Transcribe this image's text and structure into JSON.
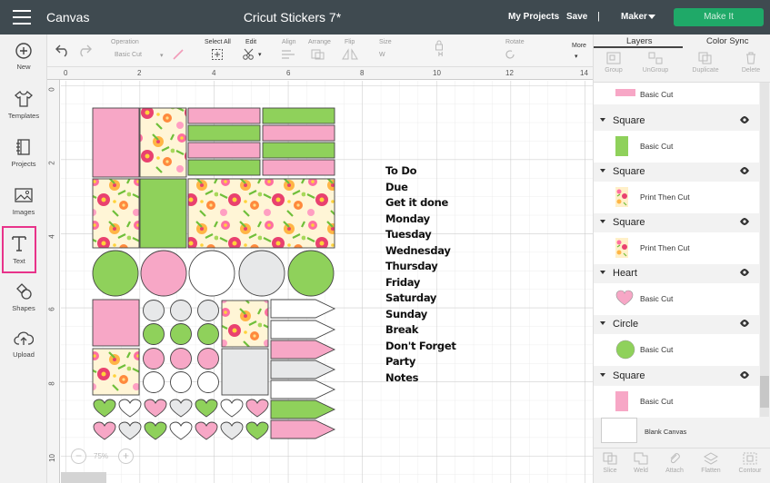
{
  "header": {
    "app_title": "Canvas",
    "doc_title": "Cricut Stickers 7*",
    "my_projects": "My Projects",
    "save": "Save",
    "separator": "|",
    "machine": "Maker",
    "make_it": "Make It"
  },
  "left_tools": [
    {
      "label": "New",
      "icon": "plus-circle-icon"
    },
    {
      "label": "Templates",
      "icon": "shirt-icon"
    },
    {
      "label": "Projects",
      "icon": "notebook-icon"
    },
    {
      "label": "Images",
      "icon": "image-icon"
    },
    {
      "label": "Text",
      "icon": "text-icon",
      "active": true
    },
    {
      "label": "Shapes",
      "icon": "shapes-icon"
    },
    {
      "label": "Upload",
      "icon": "cloud-upload-icon"
    }
  ],
  "options": {
    "operation_label": "Operation",
    "operation_value": "Basic Cut",
    "select_all": "Select All",
    "edit": "Edit",
    "align": "Align",
    "arrange": "Arrange",
    "flip": "Flip",
    "size": "Size",
    "w": "W",
    "h": "H",
    "rotate": "Rotate",
    "more": "More"
  },
  "ruler": {
    "top": [
      "0",
      "2",
      "4",
      "6",
      "8",
      "10",
      "12",
      "14"
    ],
    "left": [
      "0",
      "2",
      "4",
      "6",
      "8",
      "10"
    ]
  },
  "canvas_text": [
    "To Do",
    "Due",
    "Get it done",
    "Monday",
    "Tuesday",
    "Wednesday",
    "Thursday",
    "Friday",
    "Saturday",
    "Sunday",
    "Break",
    "Don't Forget",
    "Party",
    "Notes"
  ],
  "zoom": {
    "minus": "−",
    "value": "75%",
    "plus": "+"
  },
  "colors": {
    "pink": "#f7a7c6",
    "green": "#8fd15b",
    "white": "#ffffff",
    "grey": "#e7e8e9",
    "header": "#3f4a50",
    "make_it": "#1fa968",
    "accent_outline": "#e8338a"
  },
  "panel": {
    "tabs": [
      "Layers",
      "Color Sync"
    ],
    "tools": [
      "Group",
      "UnGroup",
      "Duplicate",
      "Delete"
    ],
    "top_row": {
      "op": "Basic Cut",
      "swatch": "pink-rect"
    },
    "layers": [
      {
        "name": "Square",
        "op": "Basic Cut",
        "thumb": "green-rect"
      },
      {
        "name": "Square",
        "op": "Print Then Cut",
        "thumb": "floral-rect"
      },
      {
        "name": "Square",
        "op": "Print Then Cut",
        "thumb": "floral-rect"
      },
      {
        "name": "Heart",
        "op": "Basic Cut",
        "thumb": "pink-heart"
      },
      {
        "name": "Circle",
        "op": "Basic Cut",
        "thumb": "green-circle"
      },
      {
        "name": "Square",
        "op": "Basic Cut",
        "thumb": "pink-rect"
      }
    ],
    "blank_canvas": "Blank Canvas",
    "bottom_tools": [
      "Slice",
      "Weld",
      "Attach",
      "Flatten",
      "Contour"
    ]
  }
}
